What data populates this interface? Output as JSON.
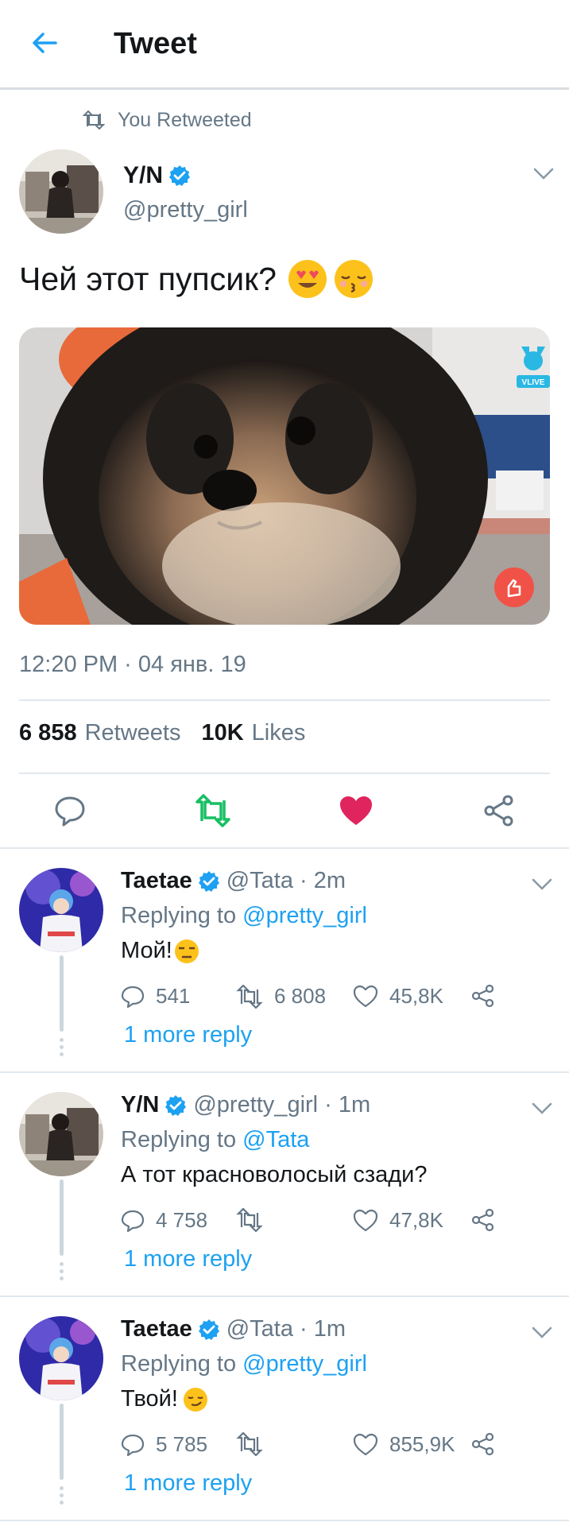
{
  "header": {
    "title": "Tweet",
    "back_icon": "arrow-left-icon"
  },
  "colors": {
    "accent": "#1da1f2",
    "like": "#e0245e",
    "retweet_active": "#17bf63",
    "muted": "#657786",
    "text": "#14171a"
  },
  "retweet_banner": {
    "icon": "retweet-icon",
    "text": "You Retweeted"
  },
  "tweet": {
    "author_name": "Y/N",
    "author_handle": "@pretty_girl",
    "verified": true,
    "text": "Чей этот пупсик?",
    "emojis": [
      "heart-eyes-emoji",
      "kissing-closed-eyes-emoji"
    ],
    "media": {
      "watermark": "VLIVE",
      "reaction_icon": "finger-heart-icon"
    },
    "timestamp": "12:20 PM · 04 янв. 19",
    "retweets_count": "6 858",
    "retweets_label": "Retweets",
    "likes_count": "10K",
    "likes_label": "Likes",
    "liked": true,
    "retweeted": true
  },
  "replies": [
    {
      "name": "Taetae",
      "handle": "@Tata · 2m",
      "replying_prefix": "Replying to",
      "replying_to": "@pretty_girl",
      "text": "Мой!",
      "emoji": "unamused-emoji",
      "reply_count": "541",
      "retweet_count": "6 808",
      "like_count": "45,8K",
      "more": "1 more reply"
    },
    {
      "name": "Y/N",
      "handle": "@pretty_girl · 1m",
      "replying_prefix": "Replying to",
      "replying_to": "@Tata",
      "text": "А тот красноволосый сзади?",
      "emoji": "",
      "reply_count": "4 758",
      "retweet_count": "",
      "like_count": "47,8K",
      "more": "1 more reply"
    },
    {
      "name": "Taetae",
      "handle": "@Tata · 1m",
      "replying_prefix": "Replying to",
      "replying_to": "@pretty_girl",
      "text": "Твой!",
      "emoji": "smirk-emoji",
      "reply_count": "5 785",
      "retweet_count": "",
      "like_count": "855,9K",
      "more": "1 more reply"
    }
  ]
}
